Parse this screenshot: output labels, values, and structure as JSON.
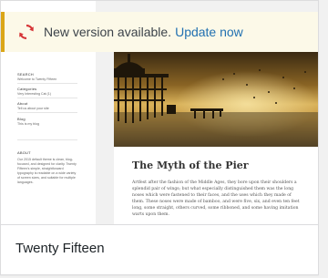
{
  "notice": {
    "message": "New version available.",
    "link": "Update now",
    "icon": "update-icon",
    "accent_color": "#dba617",
    "link_color": "#2271b1"
  },
  "preview": {
    "sidebar": {
      "search_label": "SEARCH",
      "search_text": "Welcome to Twenty Fifteen",
      "categories_label": "Categories",
      "categories_value": "Very Interesting Cat (1)",
      "about_label": "About",
      "about_text": "Tell us about your site",
      "blog_label": "Blog",
      "blog_text": "This is my blog",
      "about_heading": "ABOUT",
      "about_para": "Our 2015 default theme is clean, blog-focused, and designed for clarity. Twenty Fifteen's simple, straightforward typography is readable on a wide variety of screen sizes, and suitable for multiple languages."
    },
    "post": {
      "title": "The Myth of the Pier",
      "excerpt": "Artfest after the fashion of the Middle Ages, they bore upon their shoulders a splendid pair of wings; but what especially distinguished them was the long noses which were fastened to their faces, and the uses which they made of them. These noses were made of bamboo, and were five, six, and even ten feet long, some straight, others curved, some ribboned, and some having imitation warts upon them."
    }
  },
  "theme": {
    "name": "Twenty Fifteen"
  }
}
